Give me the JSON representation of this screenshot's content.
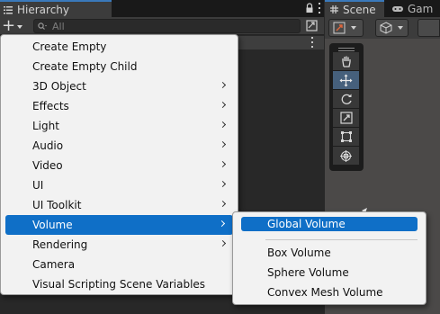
{
  "hierarchy": {
    "tab_title": "Hierarchy",
    "search_placeholder": "All"
  },
  "scene": {
    "tab_scene": "Scene",
    "tab_game": "Gam"
  },
  "context_menu": {
    "items": [
      {
        "label": "Create Empty",
        "submenu": false
      },
      {
        "label": "Create Empty Child",
        "submenu": false
      },
      {
        "label": "3D Object",
        "submenu": true
      },
      {
        "label": "Effects",
        "submenu": true
      },
      {
        "label": "Light",
        "submenu": true
      },
      {
        "label": "Audio",
        "submenu": true
      },
      {
        "label": "Video",
        "submenu": true
      },
      {
        "label": "UI",
        "submenu": true
      },
      {
        "label": "UI Toolkit",
        "submenu": true
      },
      {
        "label": "Volume",
        "submenu": true,
        "highlighted": true
      },
      {
        "label": "Rendering",
        "submenu": true
      },
      {
        "label": "Camera",
        "submenu": false
      },
      {
        "label": "Visual Scripting Scene Variables",
        "submenu": false
      }
    ]
  },
  "volume_submenu": {
    "global": "Global Volume",
    "box": "Box Volume",
    "sphere": "Sphere Volume",
    "convex": "Convex Mesh Volume"
  },
  "colors": {
    "highlight": "#0f6fc7",
    "accent_tab": "#3a79bb"
  }
}
